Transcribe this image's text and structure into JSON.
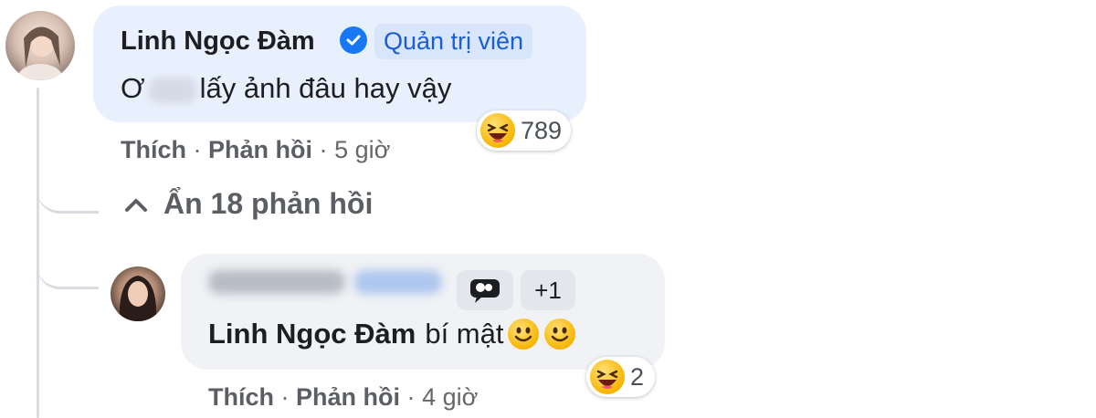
{
  "top_comment": {
    "author": "Linh Ngọc Đàm",
    "role_badge": "Quản trị viên",
    "text_prefix": "Ơ",
    "text_suffix": "lấy ảnh đâu hay vậy",
    "reaction_count": "789",
    "actions": {
      "like": "Thích",
      "reply": "Phản hồi",
      "sep": "·",
      "time": "5 giờ"
    }
  },
  "hide_replies_label": "Ẩn 18 phản hồi",
  "reply": {
    "mention": "Linh Ngọc Đàm",
    "text": "bí mật",
    "badge_more": "+1",
    "reaction_count": "2",
    "actions": {
      "like": "Thích",
      "reply": "Phản hồi",
      "sep": "·",
      "time": "4 giờ"
    }
  },
  "colors": {
    "admin_bubble": "#e9f0fd",
    "bubble": "#f0f2f5",
    "badge_text": "#1a5fd0",
    "verified": "#1877f2"
  }
}
